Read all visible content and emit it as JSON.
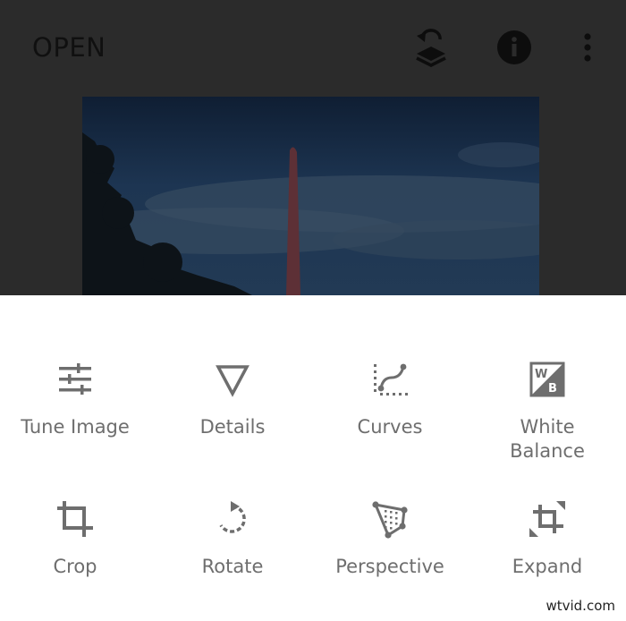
{
  "header": {
    "open_label": "OPEN"
  },
  "toolbar_icons": [
    "revert-layers-icon",
    "info-icon",
    "more-vertical-icon"
  ],
  "tools": [
    {
      "label": "Tune Image",
      "icon": "tune-sliders-icon"
    },
    {
      "label": "Details",
      "icon": "details-triangle-icon"
    },
    {
      "label": "Curves",
      "icon": "curves-icon"
    },
    {
      "label": "White\nBalance",
      "icon": "white-balance-icon"
    },
    {
      "label": "Crop",
      "icon": "crop-icon"
    },
    {
      "label": "Rotate",
      "icon": "rotate-icon"
    },
    {
      "label": "Perspective",
      "icon": "perspective-icon"
    },
    {
      "label": "Expand",
      "icon": "expand-icon"
    }
  ],
  "watermark": "wtvid.com",
  "colors": {
    "dim_overlay": "#2b2b2b",
    "icon_gray": "#6e6e6e",
    "panel": "#ffffff"
  }
}
